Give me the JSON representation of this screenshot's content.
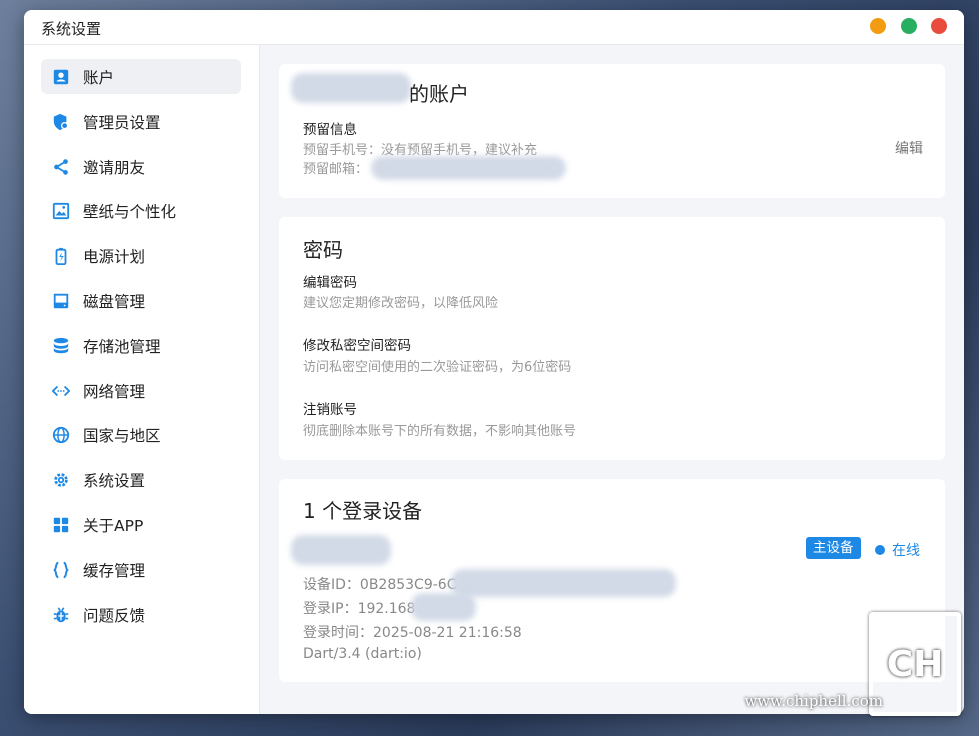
{
  "window": {
    "title": "系统设置"
  },
  "sidebar": {
    "items": [
      {
        "label": "账户",
        "icon": "account-icon"
      },
      {
        "label": "管理员设置",
        "icon": "admin-shield-icon"
      },
      {
        "label": "邀请朋友",
        "icon": "share-icon"
      },
      {
        "label": "壁纸与个性化",
        "icon": "wallpaper-icon"
      },
      {
        "label": "电源计划",
        "icon": "battery-icon"
      },
      {
        "label": "磁盘管理",
        "icon": "disk-icon"
      },
      {
        "label": "存储池管理",
        "icon": "database-icon"
      },
      {
        "label": "网络管理",
        "icon": "network-icon"
      },
      {
        "label": "国家与地区",
        "icon": "globe-icon"
      },
      {
        "label": "系统设置",
        "icon": "gear-icon"
      },
      {
        "label": "关于APP",
        "icon": "app-grid-icon"
      },
      {
        "label": "缓存管理",
        "icon": "braces-icon"
      },
      {
        "label": "问题反馈",
        "icon": "bug-icon"
      }
    ]
  },
  "account_card": {
    "title_suffix": "的账户",
    "section_label": "预留信息",
    "phone_line": "预留手机号：没有预留手机号，建议补充",
    "email_label": "预留邮箱：",
    "edit_label": "编辑"
  },
  "password_card": {
    "title": "密码",
    "items": [
      {
        "label": "编辑密码",
        "desc": "建议您定期修改密码，以降低风险"
      },
      {
        "label": "修改私密空间密码",
        "desc": "访问私密空间使用的二次验证密码，为6位密码"
      },
      {
        "label": "注销账号",
        "desc": "彻底删除本账号下的所有数据，不影响其他账号"
      }
    ]
  },
  "devices_card": {
    "title": "1 个登录设备",
    "badge": "主设备",
    "status": "在线",
    "device_id": "设备ID：0B2853C9-6C",
    "login_ip": "登录IP：192.168",
    "login_time": "登录时间：2025-08-21 21:16:58",
    "client": "Dart/3.4 (dart:io)"
  },
  "watermark": {
    "text": "www.chiphell.com"
  },
  "colors": {
    "accent": "#1e88e5",
    "close": "#e74c3c",
    "maximize": "#27ae60",
    "minimize": "#f39c12"
  }
}
